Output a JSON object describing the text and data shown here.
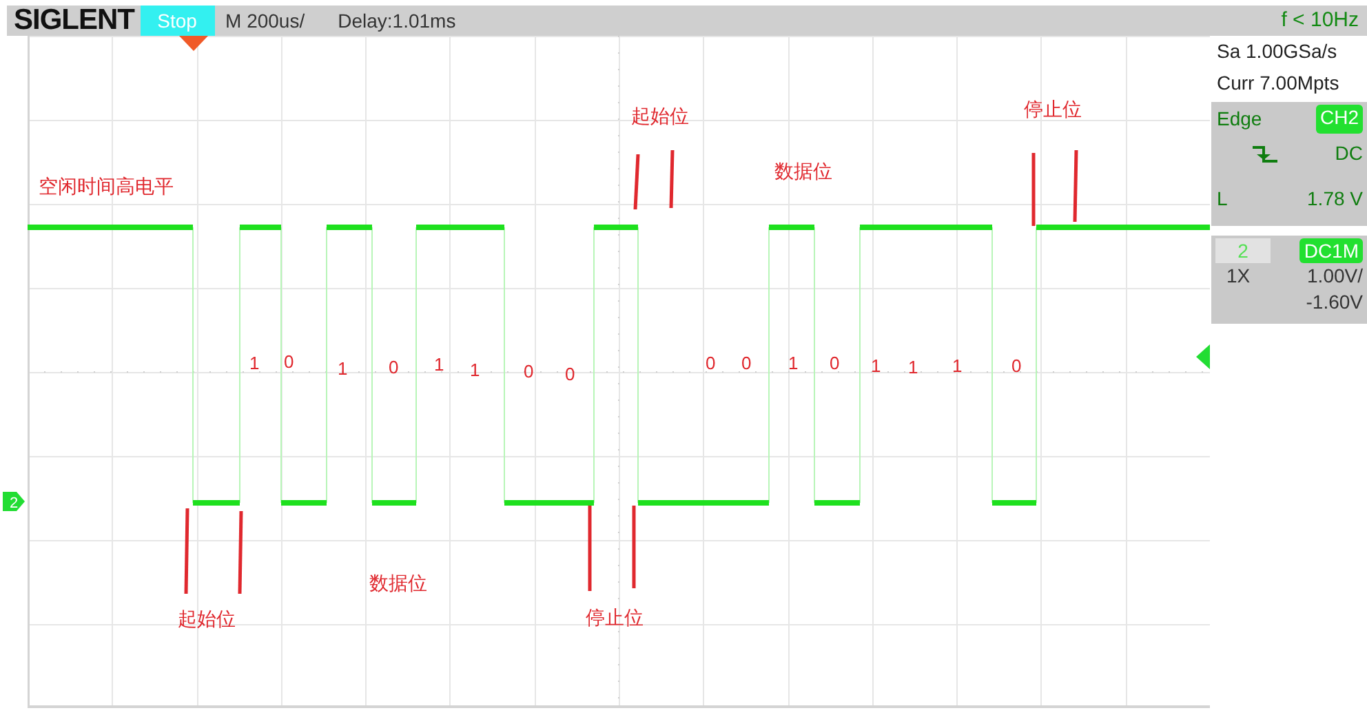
{
  "top_bar": {
    "logo": "SIGLENT",
    "run_state": "Stop",
    "timebase": "M 200us/",
    "delay": "Delay:1.01ms",
    "trigger_frequency": "f < 10Hz"
  },
  "acquisition": {
    "sample_rate": "Sa 1.00GSa/s",
    "memory_depth": "Curr 7.00Mpts"
  },
  "trigger": {
    "type": "Edge",
    "source": "CH2",
    "coupling": "DC",
    "level_label": "L",
    "level_value": "1.78 V"
  },
  "channel": {
    "number": "2",
    "coupling": "DC1M",
    "probe": "1X",
    "scale": "1.00V/",
    "offset": "-1.60V"
  },
  "annotations": [
    {
      "text": "空闲时间高电平"
    },
    {
      "text": "起始位"
    },
    {
      "text": "数据位"
    },
    {
      "text": "停止位"
    },
    {
      "text": "起始位"
    },
    {
      "text": "数据位"
    },
    {
      "text": "停止位"
    }
  ],
  "bit_labels": [
    "1",
    "0",
    "1",
    "0",
    "1",
    "1",
    "0",
    "0",
    "0",
    "0",
    "1",
    "0",
    "1",
    "1",
    "1",
    "0"
  ],
  "channel_marker": "2"
}
